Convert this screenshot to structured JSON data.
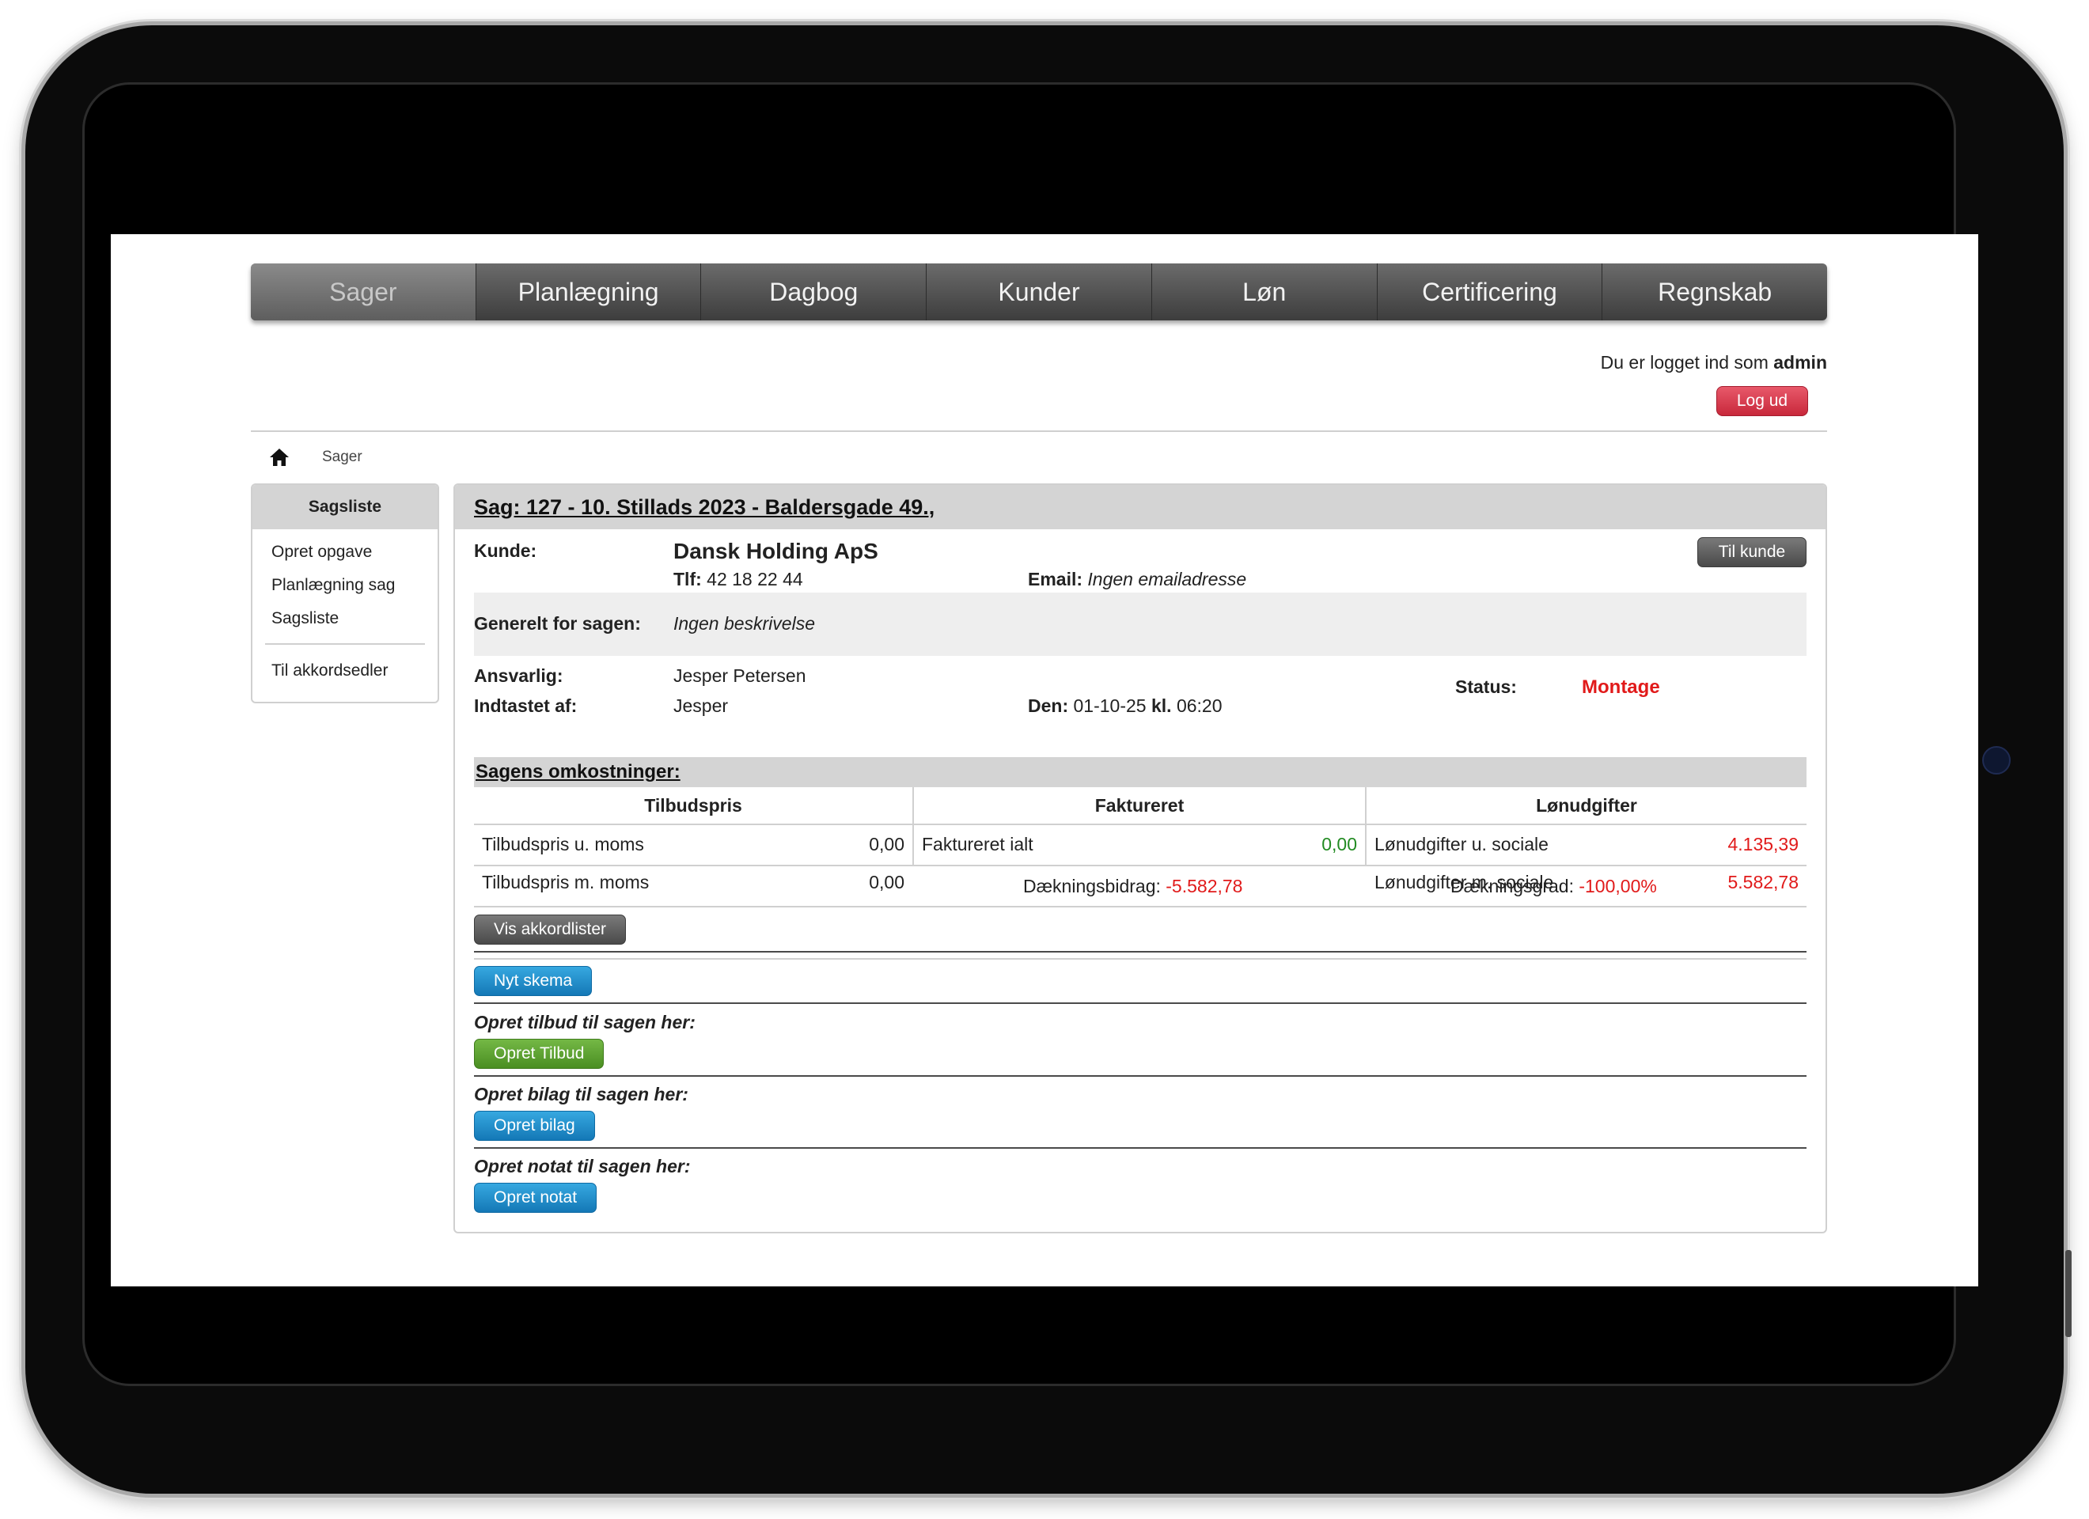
{
  "nav": {
    "items": [
      "Sager",
      "Planlægning",
      "Dagbog",
      "Kunder",
      "Løn",
      "Certificering",
      "Regnskab"
    ],
    "active": "Sager"
  },
  "user": {
    "login_prefix": "Du er logget ind som",
    "username": "admin",
    "logout_label": "Log ud"
  },
  "breadcrumb": {
    "current": "Sager"
  },
  "sidebar": {
    "title": "Sagsliste",
    "items": [
      "Opret opgave",
      "Planlægning sag",
      "Sagsliste"
    ],
    "extra_item": "Til akkordsedler"
  },
  "case": {
    "title": "Sag: 127 - 10. Stillads 2023 - Baldersgade 49.,",
    "kunde_label": "Kunde:",
    "kunde_value": "Dansk Holding ApS",
    "tlf_label": "Tlf:",
    "tlf_value": "42 18 22 44",
    "email_label": "Email:",
    "email_value": "Ingen emailadresse",
    "til_kunde_label": "Til kunde",
    "generelt_label": "Generelt for sagen:",
    "generelt_value": "Ingen beskrivelse",
    "ansvarlig_label": "Ansvarlig:",
    "ansvarlig_value": "Jesper Petersen",
    "indtastet_label": "Indtastet af:",
    "indtastet_value": "Jesper",
    "den_label": "Den:",
    "den_value": "01-10-25",
    "kl_label": "kl.",
    "kl_value": "06:20",
    "status_label": "Status:",
    "status_value": "Montage"
  },
  "costs": {
    "title": "Sagens omkostninger:",
    "columns": {
      "tilbud": {
        "header": "Tilbudspris",
        "rows": [
          {
            "label": "Tilbudspris u. moms",
            "value": "0,00"
          },
          {
            "label": "Tilbudspris m. moms",
            "value": "0,00"
          }
        ]
      },
      "faktureret": {
        "header": "Faktureret",
        "rows": [
          {
            "label": "Faktureret ialt",
            "value": "0,00"
          }
        ]
      },
      "lon": {
        "header": "Lønudgifter",
        "rows": [
          {
            "label": "Lønudgifter u. sociale",
            "value": "4.135,39"
          },
          {
            "label": "Lønudgifter m. sociale",
            "value": "5.582,78"
          }
        ]
      }
    },
    "daekningsbidrag_label": "Dækningsbidrag:",
    "daekningsbidrag_value": "-5.582,78",
    "daekningsgrad_label": "Dækningsgrad:",
    "daekningsgrad_value": "-100,00%"
  },
  "actions": {
    "vis_akkordlister": "Vis akkordlister",
    "nyt_skema": "Nyt skema",
    "tilbud_label": "Opret tilbud til sagen her:",
    "tilbud_button": "Opret Tilbud",
    "bilag_label": "Opret bilag til sagen her:",
    "bilag_button": "Opret bilag",
    "notat_label": "Opret notat til sagen her:",
    "notat_button": "Opret notat"
  },
  "colors": {
    "status": "#e11a1a",
    "positive": "#228b22",
    "negative": "#e11a1a",
    "logout": "#d63447",
    "primary_button": "#1b8ccc",
    "success_button": "#5a9f2e"
  }
}
